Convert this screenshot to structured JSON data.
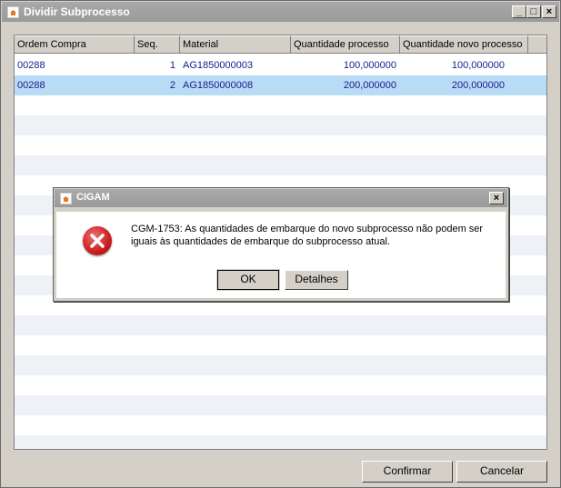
{
  "window": {
    "title": "Dividir Subprocesso",
    "minimize_glyph": "_",
    "maximize_glyph": "□",
    "close_glyph": "×"
  },
  "grid": {
    "columns": [
      "Ordem Compra",
      "Seq.",
      "Material",
      "Quantidade processo",
      "Quantidade novo processo"
    ],
    "rows": [
      {
        "ordem": "00288",
        "seq": "1",
        "material": "AG1850000003",
        "qtd": "100,000000",
        "qtd_novo": "100,000000",
        "selected": false
      },
      {
        "ordem": "00288",
        "seq": "2",
        "material": "AG1850000008",
        "qtd": "200,000000",
        "qtd_novo": "200,000000",
        "selected": true
      }
    ]
  },
  "buttons": {
    "confirm": "Confirmar",
    "cancel": "Cancelar"
  },
  "dialog": {
    "title": "CIGAM",
    "close_glyph": "×",
    "message_line1": "CGM-1753: As quantidades de embarque do novo subprocesso não podem ser",
    "message_line2": "iguais às quantidades de embarque do subprocesso atual.",
    "ok": "OK",
    "details": "Detalhes",
    "icon": "error-icon"
  },
  "colors": {
    "selected_row": "#b8dcf6",
    "alt_row": "#eef2f6",
    "cell_text": "#1a1a8c",
    "titlebar": "#a0a0a0"
  }
}
